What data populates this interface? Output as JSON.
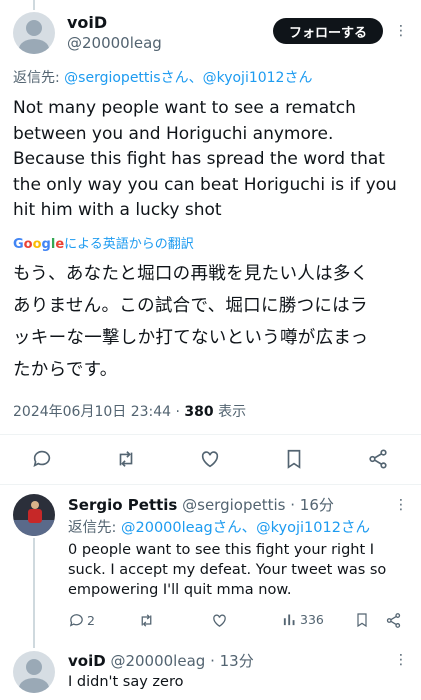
{
  "main_tweet": {
    "display_name": "voiD",
    "handle": "@20000leag",
    "follow_label": "フォローする",
    "reply_prefix": "返信先: ",
    "reply_to": "@sergiopettisさん、@kyoji1012さん",
    "text": "Not many people want to see a rematch\nbetween you and Horiguchi anymore.\nBecause this fight has spread the word that\nthe only way you can beat Horiguchi is if you\nhit him with a lucky shot",
    "translate_brand": "Google",
    "translate_label": "による英語からの翻訳",
    "translation": "もう、あなたと堀口の再戦を見たい人は多く\nありません。この試合で、堀口に勝つにはラ\nッキーな一撃しか打てないという噂が広まっ\nたからです。",
    "timestamp": "2024年06月10日 23:44",
    "separator": "·",
    "views_count": "380",
    "views_label": "表示"
  },
  "reply1": {
    "display_name": "Sergio Pettis",
    "handle": "@sergiopettis",
    "time": "· 16分",
    "reply_prefix": "返信先: ",
    "reply_to": "@20000leagさん、@kyoji1012さん",
    "text": "0 people want to see this fight your right I\nsuck. I accept my defeat. Your tweet was so\nempowering I'll quit mma now.",
    "reply_count": "2",
    "views_count": "336"
  },
  "reply2": {
    "display_name": "voiD",
    "handle": "@20000leag",
    "time": "· 13分",
    "text": "I didn't say zero"
  },
  "colors": {
    "accent": "#1d9bf0",
    "text": "#0f1419",
    "secondary": "#536471"
  }
}
